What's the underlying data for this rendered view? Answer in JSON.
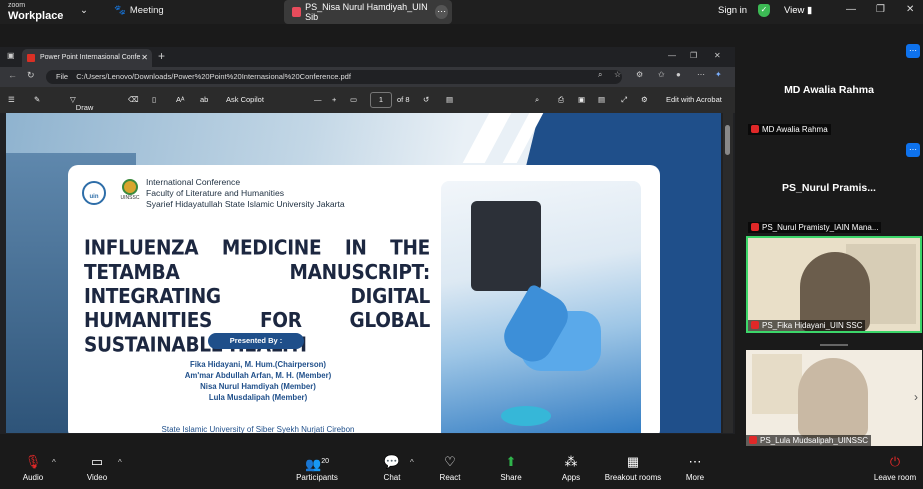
{
  "zoom": {
    "logo_small": "zoom",
    "logo_big": "Workplace",
    "meeting_label": "Meeting",
    "share_tab": "PS_Nisa Nurul Hamdiyah_UIN Sib",
    "sign_in": "Sign in",
    "view": "View"
  },
  "browser": {
    "tab_title": "Power Point Internasional Confe",
    "file_label": "File",
    "url": "C:/Users/Lenovo/Downloads/Power%20Point%20Internasional%20Conference.pdf",
    "toolbar": {
      "draw": "Draw",
      "ask_copilot": "Ask Copilot",
      "page": "1",
      "of_pages": "of 8",
      "edit_acrobat": "Edit with Acrobat"
    }
  },
  "slide": {
    "conference_line1": "International Conference",
    "conference_line2": "Faculty of Literature and Humanities",
    "conference_line3": "Syarief Hidayatullah State Islamic University Jakarta",
    "logo1_text": "uin",
    "logo2_text": "UINSSC",
    "title": "INFLUENZA MEDICINE IN THE TETAMBA MANUSCRIPT: INTEGRATING DIGITAL HUMANITIES FOR GLOBAL SUSTAINABLE HEALTH",
    "presented_by": "Presented By :",
    "members": [
      "Fika Hidayani, M. Hum.(Chairperson)",
      "Am'mar Abdullah Arfan, M. H. (Member)",
      "Nisa Nurul Hamdiyah (Member)",
      "Lula Musdalipah (Member)"
    ],
    "institution": "State Islamic University of Siber Syekh Nurjati Cirebon"
  },
  "participants_panel": {
    "tile1_name": "MD Awalia Rahma",
    "tile1_label": "MD Awalia Rahma",
    "tile2_name": "PS_Nurul  Pramis...",
    "tile2_label": "PS_Nurul Pramisty_IAIN Mana...",
    "tile3_label": "PS_Fika Hidayani_UIN SSC",
    "tile4_label": "PS_Lula Mudsalipah_UINSSC"
  },
  "bottom_bar": {
    "audio": "Audio",
    "video": "Video",
    "participants": "Participants",
    "participants_count": "20",
    "chat": "Chat",
    "react": "React",
    "share": "Share",
    "apps": "Apps",
    "breakout": "Breakout rooms",
    "more": "More",
    "leave": "Leave room"
  },
  "colors": {
    "accent_blue": "#1f4f8a",
    "zoom_blue": "#0e72ed",
    "share_green": "#2fb34b",
    "mute_red": "#e02828"
  }
}
